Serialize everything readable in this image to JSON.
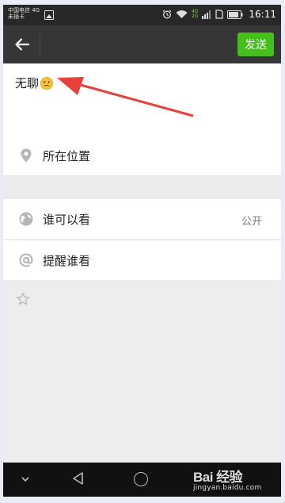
{
  "status_bar": {
    "carrier_line1": "中国电信 4G",
    "carrier_line2": "未插卡",
    "network_top": "4G",
    "network_bottom": "2G",
    "time": "16:11"
  },
  "top_bar": {
    "send_label": "发送"
  },
  "compose": {
    "text": "无聊",
    "emoji_icon": "confused-face-emoji"
  },
  "location": {
    "label": "所在位置",
    "icon": "location-pin-icon"
  },
  "visibility": {
    "label": "谁可以看",
    "value": "公开",
    "icon": "globe-icon"
  },
  "mention": {
    "label": "提醒谁看",
    "icon": "at-sign-icon"
  },
  "favorite": {
    "icon": "star-icon"
  },
  "watermark": {
    "brand": "Bai 经验",
    "url": "jingyan.baidu.com"
  },
  "colors": {
    "send_button": "#45c01a",
    "top_bar": "#363636",
    "arrow": "#e8403a"
  }
}
